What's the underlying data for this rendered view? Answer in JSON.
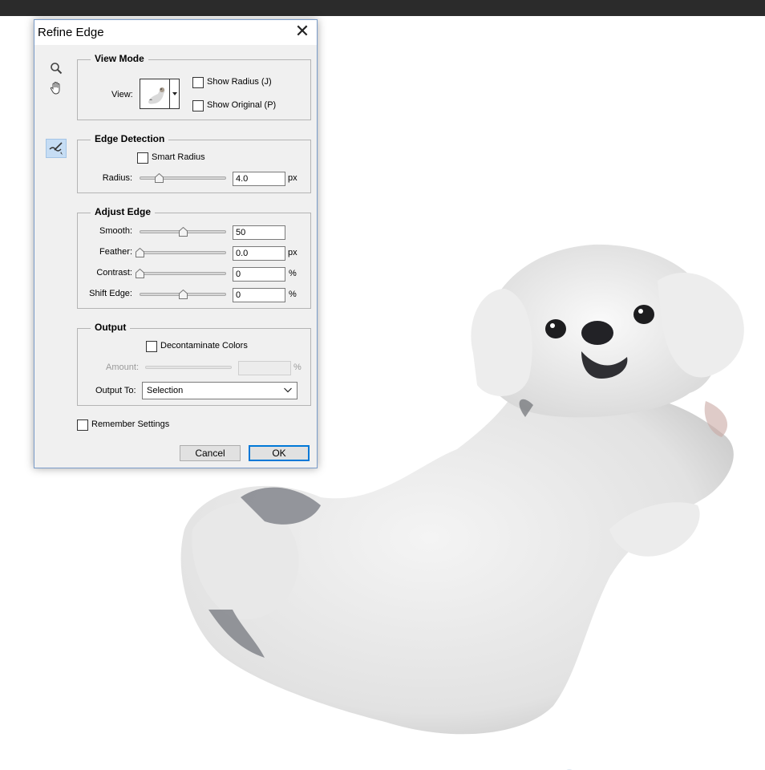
{
  "dialog": {
    "title": "Refine Edge",
    "close_glyph": "✕"
  },
  "tools": [
    "zoom-icon",
    "hand-icon",
    "refine-radius-brush-icon"
  ],
  "view_mode": {
    "legend": "View Mode",
    "view_label": "View:",
    "show_radius": {
      "label": "Show Radius (J)",
      "checked": false
    },
    "show_original": {
      "label": "Show Original (P)",
      "checked": false
    }
  },
  "edge_detection": {
    "legend": "Edge Detection",
    "smart_radius": {
      "label": "Smart Radius",
      "checked": false
    },
    "radius": {
      "label": "Radius:",
      "value": "4.0",
      "unit": "px",
      "position": 0.2
    }
  },
  "adjust_edge": {
    "legend": "Adjust Edge",
    "smooth": {
      "label": "Smooth:",
      "value": "50",
      "unit": "",
      "position": 0.5
    },
    "feather": {
      "label": "Feather:",
      "value": "0.0",
      "unit": "px",
      "position": 0.0
    },
    "contrast": {
      "label": "Contrast:",
      "value": "0",
      "unit": "%",
      "position": 0.0
    },
    "shift_edge": {
      "label": "Shift Edge:",
      "value": "0",
      "unit": "%",
      "position": 0.5
    }
  },
  "output": {
    "legend": "Output",
    "decontaminate": {
      "label": "Decontaminate Colors",
      "checked": false
    },
    "amount": {
      "label": "Amount:",
      "value": "",
      "unit": "%",
      "enabled": false
    },
    "output_to": {
      "label": "Output To:",
      "selected": "Selection"
    }
  },
  "remember_settings": {
    "label": "Remember Settings",
    "checked": false
  },
  "buttons": {
    "cancel": "Cancel",
    "ok": "OK"
  },
  "colors": {
    "accent": "#0078d7",
    "dialog_bg": "#f0f0f0",
    "topbar": "#2b2b2b"
  }
}
